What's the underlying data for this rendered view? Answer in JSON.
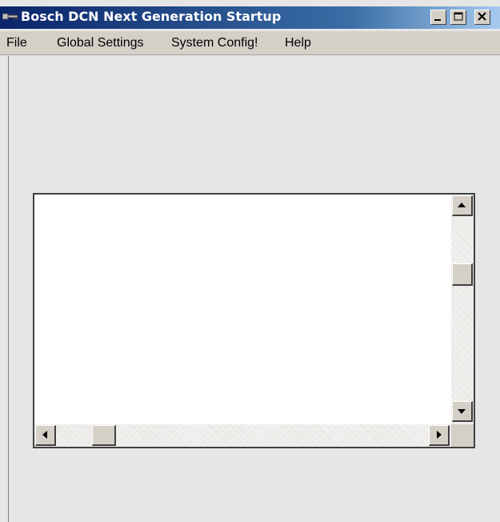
{
  "window": {
    "title": "Bosch DCN Next Generation Startup",
    "icon": "key-icon",
    "caption_buttons": [
      "minimize-icon",
      "maximize-icon",
      "close-icon"
    ]
  },
  "menubar": {
    "items": [
      {
        "label": "File"
      },
      {
        "label": "Global Settings"
      },
      {
        "label": "System Config!"
      },
      {
        "label": "Help"
      }
    ]
  },
  "listbox": {
    "content": "",
    "scrollbars": {
      "vertical": {
        "up_icon": "arrow-up-icon",
        "down_icon": "arrow-down-icon"
      },
      "horizontal": {
        "left_icon": "arrow-left-icon",
        "right_icon": "arrow-right-icon"
      }
    }
  },
  "colors": {
    "titlebar_start": "#0a246a",
    "titlebar_end": "#a6caf0",
    "face": "#d4d0c8",
    "client_bg": "#e6e6e6"
  }
}
